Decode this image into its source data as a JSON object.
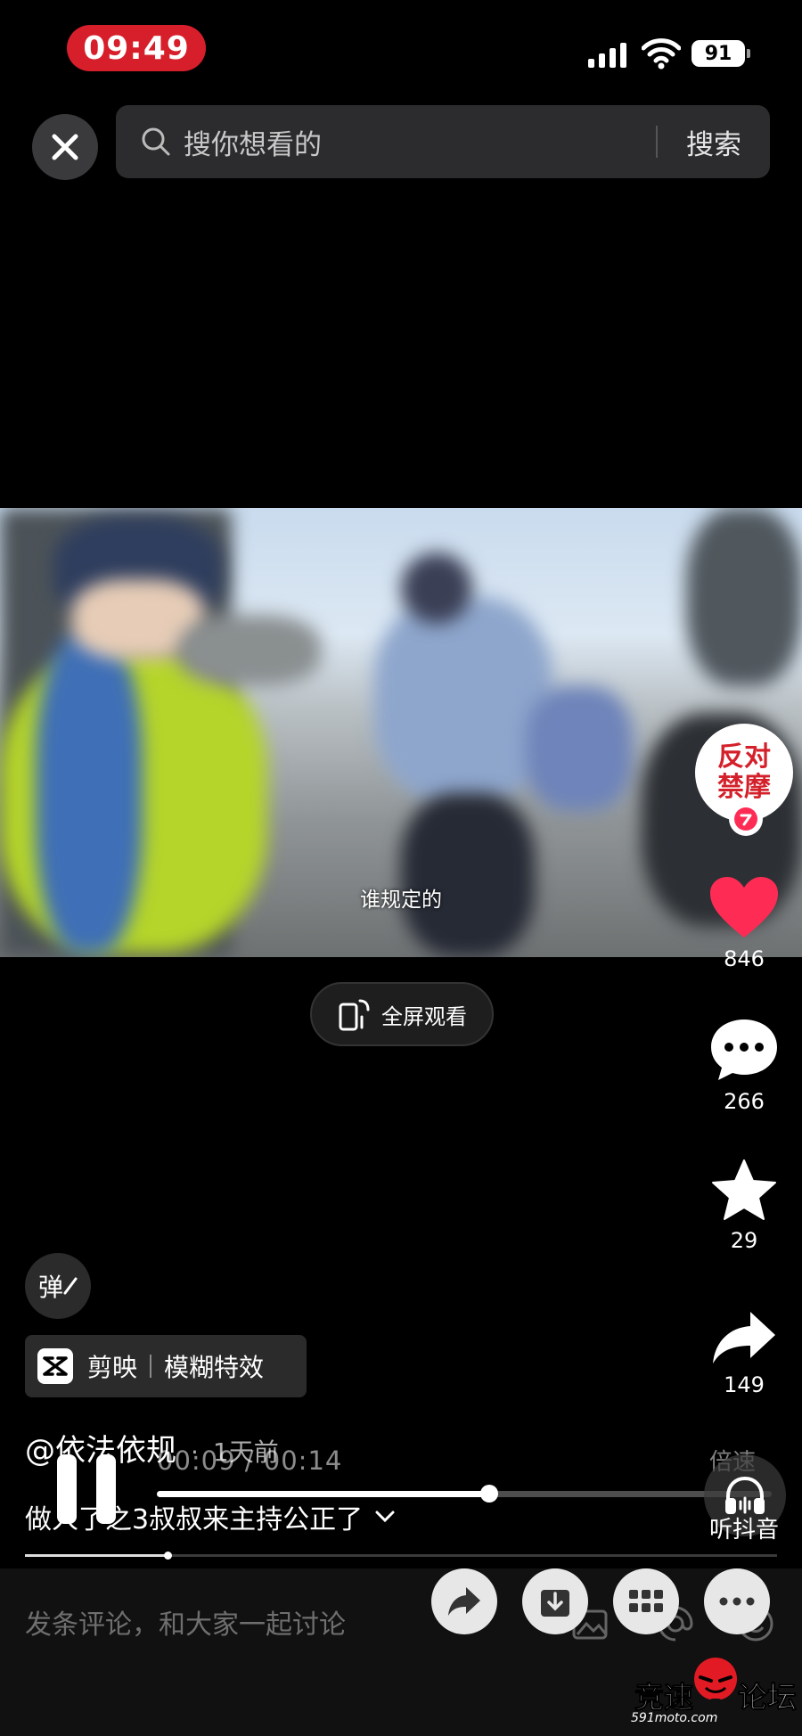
{
  "status_bar": {
    "time": "09:49",
    "battery": "91"
  },
  "search": {
    "placeholder": "搜你想看的",
    "button_label": "搜索"
  },
  "video": {
    "subtitle": "谁规定的"
  },
  "creator": {
    "avatar_text": "反对禁摩"
  },
  "actions": {
    "likes": "846",
    "comments": "266",
    "favorites": "29",
    "shares": "149"
  },
  "fullscreen": {
    "label": "全屏观看"
  },
  "danmu": {
    "label": "弹"
  },
  "capcut_chip": {
    "app": "剪映",
    "effect": "模糊特效"
  },
  "post": {
    "author": "@依法依规",
    "separator": "·",
    "posted": "1天前",
    "caption": "做人了之3叔叔来主持公正了"
  },
  "playback": {
    "time_readout": "00:09 / 00:14",
    "progress_fraction": 0.54,
    "speed_label": "倍速",
    "listen_label": "听抖音"
  },
  "mini_progress_fraction": 0.19,
  "comment_bar": {
    "placeholder": "发条评论，和大家一起讨论"
  },
  "watermark": {
    "text_left": "竞速",
    "text_right": "论坛",
    "url": "591moto.com"
  },
  "colors": {
    "status_pill": "#d61f2a",
    "like_heart": "#fe2c55",
    "avatar_text": "#d4202a"
  },
  "icons": [
    "close-icon",
    "search-icon",
    "heart-icon",
    "comment-icon",
    "star-icon",
    "share-icon",
    "fullscreen-phone-icon",
    "capcut-icon",
    "headphones-icon",
    "pause-icon",
    "forward-icon",
    "download-icon",
    "grid-icon",
    "more-icon"
  ]
}
